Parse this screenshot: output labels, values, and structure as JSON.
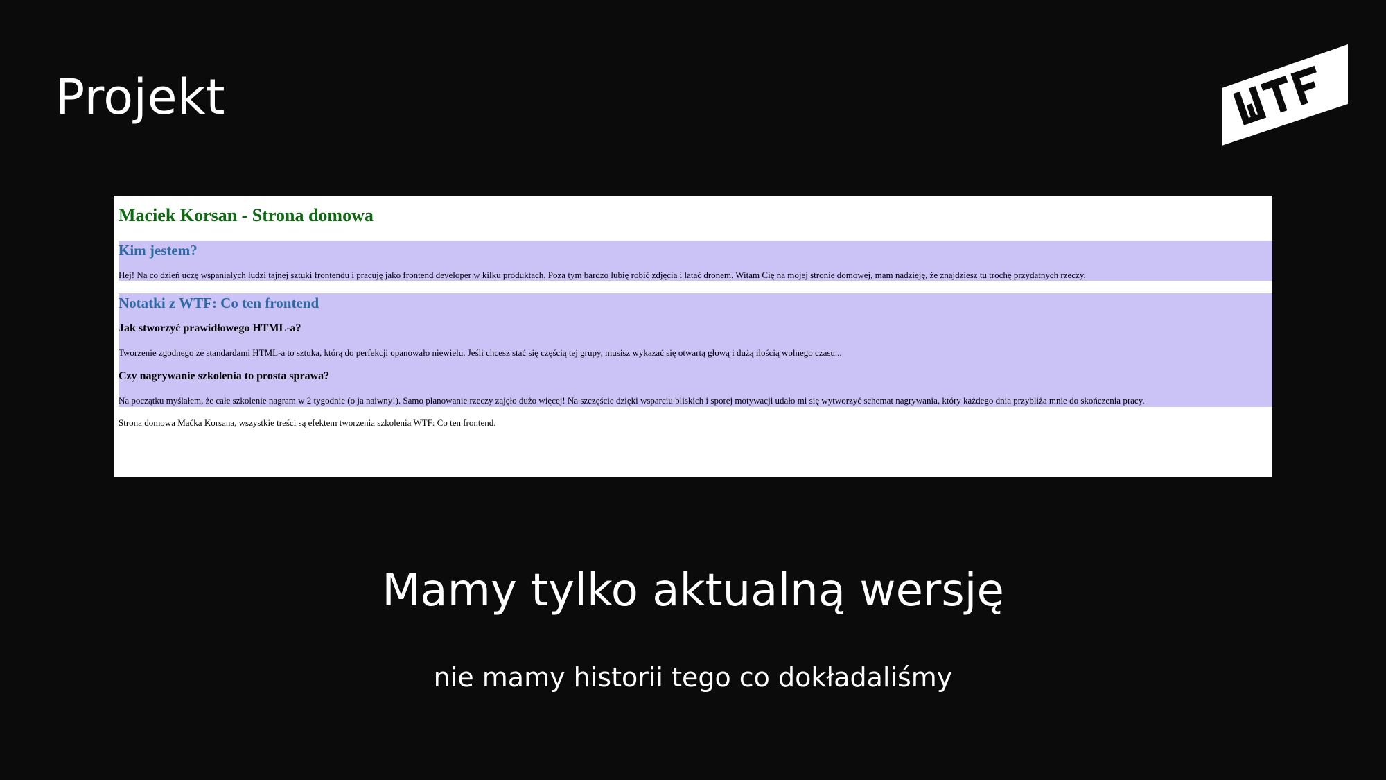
{
  "slide": {
    "title": "Projekt",
    "headline": "Mamy tylko aktualną wersję",
    "subline": "nie mamy historii tego co dokładaliśmy",
    "logo_text": "WTF"
  },
  "embedded_page": {
    "title": "Maciek Korsan - Strona domowa",
    "about_heading": "Kim jestem?",
    "about_text": "Hej! Na co dzień uczę wspaniałych ludzi tajnej sztuki frontendu i pracuję jako frontend developer w kilku produktach. Poza tym bardzo lubię robić zdjęcia i latać dronem. Witam Cię na mojej stronie domowej, mam nadzieję, że znajdziesz tu trochę przydatnych rzeczy.",
    "notes_heading": "Notatki z WTF: Co ten frontend",
    "note1_heading": "Jak stworzyć prawidłowego HTML-a?",
    "note1_text": "Tworzenie zgodnego ze standardami HTML-a to sztuka, którą do perfekcji opanowało niewielu. Jeśli chcesz stać się częścią tej grupy, musisz wykazać się otwartą głową i dużą ilością wolnego czasu...",
    "note2_heading": "Czy nagrywanie szkolenia to prosta sprawa?",
    "note2_text": "Na początku myślałem, że całe szkolenie nagram w 2 tygodnie (o ja naiwny!). Samo planowanie rzeczy zajęło dużo więcej! Na szczęście dzięki wsparciu bliskich i sporej motywacji udało mi się wytworzyć schemat nagrywania, który każdego dnia przybliża mnie do skończenia pracy.",
    "footer": "Strona domowa Maćka Korsana, wszystkie treści są efektem tworzenia szkolenia WTF: Co ten frontend."
  },
  "colors": {
    "background": "#0b0b0c",
    "text": "#ffffff",
    "page_title_green": "#0e6b12",
    "heading_blue": "#2d6aa6",
    "band_lavender": "#cbc3f6"
  }
}
